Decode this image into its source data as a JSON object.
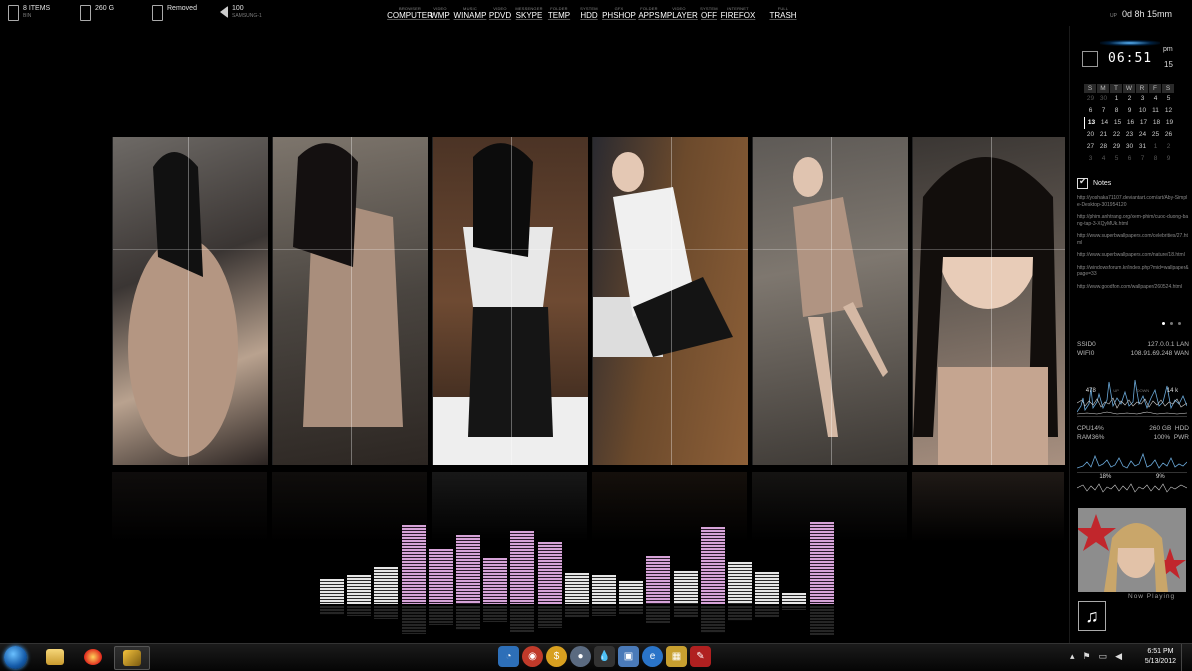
{
  "topbar": {
    "bin": {
      "main": "8 ITEMS",
      "sub": "BIN"
    },
    "disk": {
      "main": "260 G"
    },
    "usb": {
      "main": "Removed"
    },
    "volume": {
      "main": "100",
      "sub": "SAMSUNG-1"
    },
    "launchers": [
      {
        "cap": "BROWSER",
        "label": "COMPUTER"
      },
      {
        "cap": "VIDEO",
        "label": "WMP"
      },
      {
        "cap": "MUSIC",
        "label": "WINAMP"
      },
      {
        "cap": "VIDEO",
        "label": "PDVD"
      },
      {
        "cap": "MESSENGER",
        "label": "SKYPE"
      },
      {
        "cap": "FOLDER",
        "label": "TEMP"
      },
      {
        "cap": "SYSTEM",
        "label": "HDD"
      },
      {
        "cap": "GFX",
        "label": "PHSHOP"
      },
      {
        "cap": "FOLDER",
        "label": "APPS"
      },
      {
        "cap": "VIDEO",
        "label": "MPLAYER"
      },
      {
        "cap": "SYSTEM",
        "label": "OFF"
      },
      {
        "cap": "INTERNET",
        "label": "FIREFOX"
      },
      {
        "cap": "FULL",
        "label": "TRASH"
      }
    ],
    "uptime": {
      "key": "UP",
      "value": "0d 8h 15mm"
    }
  },
  "clock": {
    "time": "06:51",
    "ampm": "pm",
    "seconds": "15"
  },
  "calendar": {
    "days": [
      "S",
      "M",
      "T",
      "W",
      "R",
      "F",
      "S"
    ],
    "weeks": [
      [
        "29",
        "30",
        "1",
        "2",
        "3",
        "4",
        "5"
      ],
      [
        "6",
        "7",
        "8",
        "9",
        "10",
        "11",
        "12"
      ],
      [
        "13",
        "14",
        "15",
        "16",
        "17",
        "18",
        "19"
      ],
      [
        "20",
        "21",
        "22",
        "23",
        "24",
        "25",
        "26"
      ],
      [
        "27",
        "28",
        "29",
        "30",
        "31",
        "1",
        "2"
      ],
      [
        "3",
        "4",
        "5",
        "6",
        "7",
        "8",
        "9"
      ]
    ],
    "today": "13"
  },
  "notes": {
    "title": "Notes",
    "lines": [
      "http://yoshaka71107.deviantart.com/art/Aby-Simple-Desktop-301954120",
      "http://phim.anhtrang.org/xem-phim/cuoc-duong-bang-tap-3-XQyMUk.html",
      "http://www.superbwallpapers.com/celebrities/27.html",
      "http://www.superbwallpapers.com/nature/18.html",
      "http://windowsforum.kr/index.php?mid=wallpaper&page=33",
      "http://www.goodfon.com/wallpaper/260524.html"
    ]
  },
  "network": {
    "ssid_key": "SSID",
    "ssid_val": "0",
    "ip_local": "127.0.0.1",
    "lan_key": "LAN",
    "wifi_key": "WIFI",
    "wifi_val": "0",
    "ip_wan": "108.91.69.248",
    "wan_key": "WAN",
    "up": "478",
    "up_key": "UP",
    "down_key": "DOWN",
    "down": "14 k"
  },
  "system": {
    "cpu_key": "CPU",
    "cpu": "14%",
    "hdd_size": "260 GB",
    "hdd_key": "HDD",
    "ram_key": "RAM",
    "ram": "36%",
    "pwr": "100%",
    "pwr_key": "PWR",
    "foot_a": "18%",
    "foot_b": "9%"
  },
  "now_playing": {
    "label": "Now Playing",
    "icon": "music-note-icon"
  },
  "equalizer": {
    "levels": [
      0.28,
      0.33,
      0.42,
      0.9,
      0.62,
      0.78,
      0.52,
      0.83,
      0.7,
      0.35,
      0.33,
      0.26,
      0.55,
      0.37,
      0.88,
      0.48,
      0.36,
      0.12,
      0.93
    ],
    "color_high": "#d6a3d8",
    "color_low": "#e6e6e6"
  },
  "taskbar": {
    "time": "6:51 PM",
    "date": "5/13/2012"
  },
  "colors": {
    "accent": "#5ab8ff",
    "background": "#000000"
  }
}
